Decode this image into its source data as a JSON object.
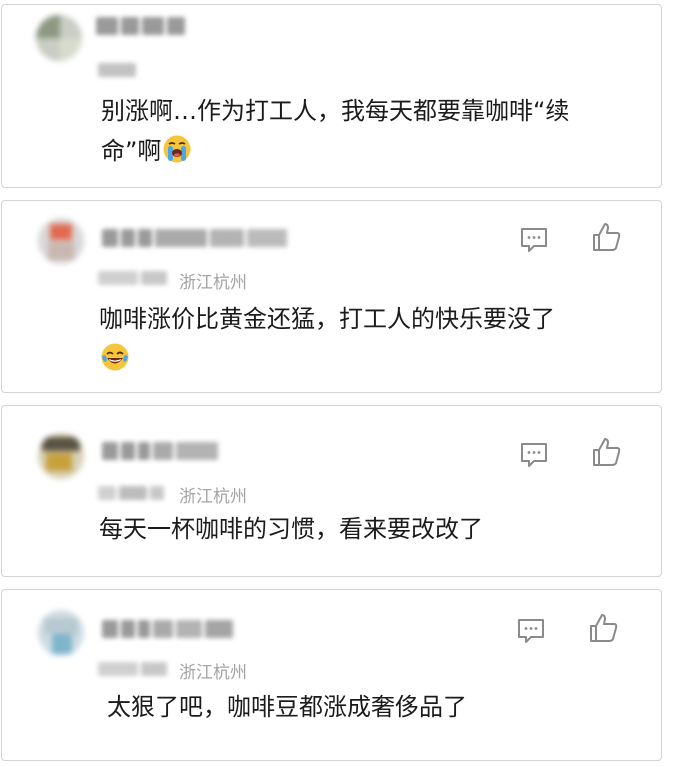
{
  "comments": [
    {
      "text_line1": "别涨啊…作为打工人，我每天都要靠咖啡“续",
      "text_line2": "命”啊",
      "emoji": "loudly-crying-face-icon"
    },
    {
      "location": "浙江杭州",
      "text_line1": "咖啡涨价比黄金还猛，打工人的快乐要没了",
      "emoji": "tears-of-joy-face-icon"
    },
    {
      "location": "浙江杭州",
      "text_line1": "每天一杯咖啡的习惯，看来要改改了"
    },
    {
      "location": "浙江杭州",
      "text_line1": "太狠了吧，咖啡豆都涨成奢侈品了"
    }
  ],
  "icons": {
    "comment": "comment-bubble-icon",
    "like": "thumbs-up-icon"
  },
  "colors": {
    "text": "#1b1b1b",
    "location": "#a3a3a3",
    "icon": "#8a8a8a",
    "border": "#d4d4d4"
  }
}
